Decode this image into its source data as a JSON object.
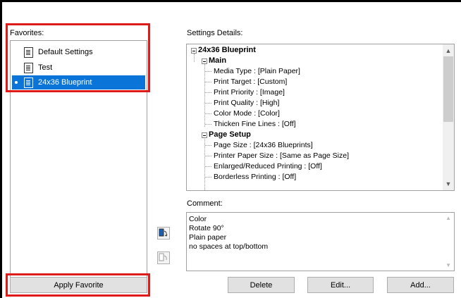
{
  "favorites": {
    "label": "Favorites:",
    "items": [
      {
        "label": "Default Settings",
        "selected": false
      },
      {
        "label": "Test",
        "selected": false
      },
      {
        "label": "24x36 Blueprint",
        "selected": true
      }
    ],
    "apply_label": "Apply Favorite"
  },
  "details": {
    "label": "Settings Details:",
    "tree": {
      "root": "24x36 Blueprint",
      "main": {
        "label": "Main",
        "items": [
          "Media Type : [Plain Paper]",
          "Print Target : [Custom]",
          "Print Priority : [Image]",
          "Print Quality : [High]",
          "Color Mode : [Color]",
          "Thicken Fine Lines : [Off]"
        ]
      },
      "page_setup": {
        "label": "Page Setup",
        "items": [
          "Page Size : [24x36 Blueprints]",
          "Printer Paper Size : [Same as Page Size]",
          "Enlarged/Reduced Printing : [Off]",
          "Borderless Printing : [Off]"
        ]
      }
    }
  },
  "comment": {
    "label": "Comment:",
    "lines": [
      "Color",
      "Rotate 90°",
      "Plain paper",
      "no spaces at top/bottom"
    ]
  },
  "buttons": {
    "delete": "Delete",
    "edit": "Edit...",
    "add": "Add..."
  },
  "colors": {
    "highlight": "#e01919",
    "selection": "#0a74d8"
  }
}
